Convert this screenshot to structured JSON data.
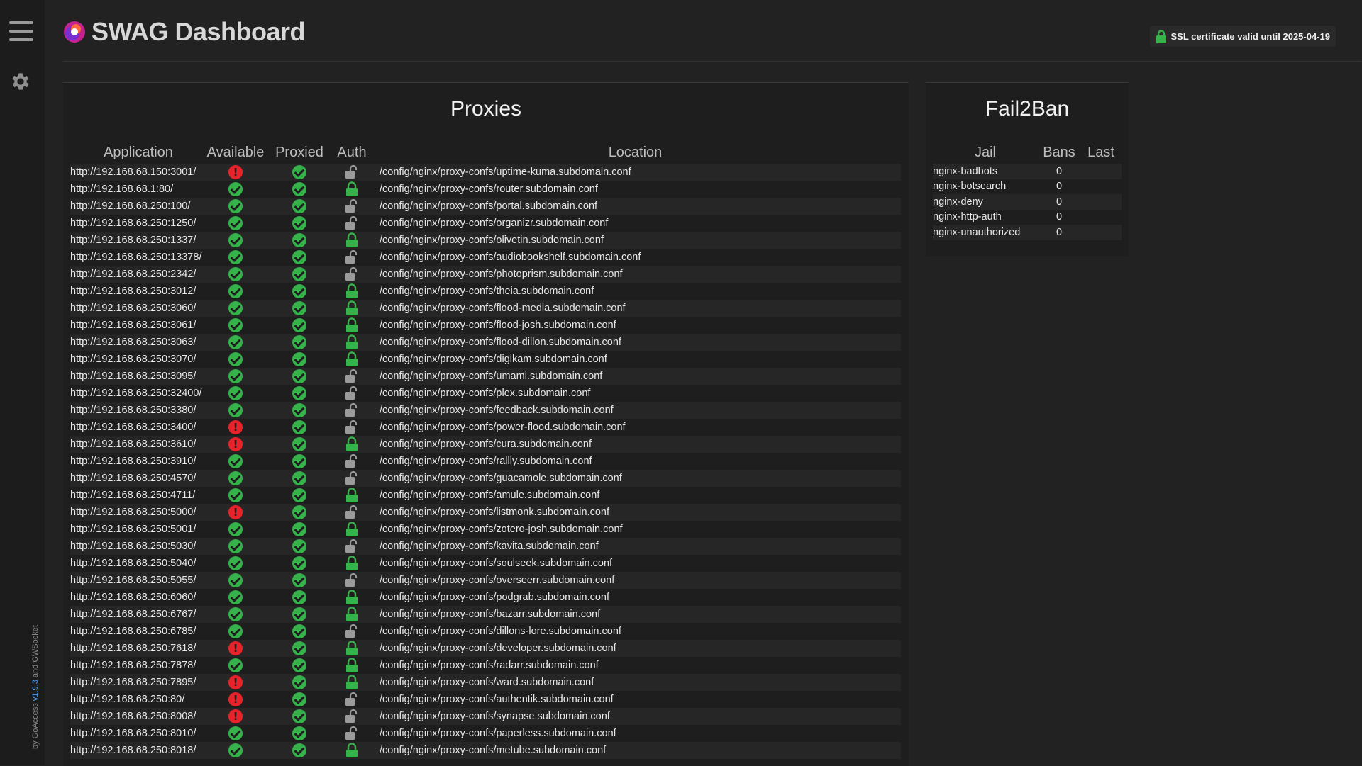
{
  "nav": {
    "menu_icon": "hamburger-menu-icon",
    "settings_icon": "gear-icon"
  },
  "credits": {
    "prefix": "by GoAccess",
    "version": "v1.9.3",
    "joiner": "and",
    "suffix": "GWSocket"
  },
  "header": {
    "title": "SWAG Dashboard",
    "ssl_text": "SSL certificate valid until 2025-04-19",
    "ssl_icon": "lock-closed-icon"
  },
  "colors": {
    "ok": "#35b24a",
    "error": "#e8232a",
    "lock_closed": "#35b24a",
    "lock_open": "#9a9a9a",
    "background": "#222222"
  },
  "proxies": {
    "title": "Proxies",
    "columns": [
      "Application",
      "Available",
      "Proxied",
      "Auth",
      "Location"
    ],
    "rows": [
      {
        "app": "http://192.168.68.150:3001/",
        "available": false,
        "proxied": true,
        "auth": false,
        "location": "/config/nginx/proxy-confs/uptime-kuma.subdomain.conf"
      },
      {
        "app": "http://192.168.68.1:80/",
        "available": true,
        "proxied": true,
        "auth": true,
        "location": "/config/nginx/proxy-confs/router.subdomain.conf"
      },
      {
        "app": "http://192.168.68.250:100/",
        "available": true,
        "proxied": true,
        "auth": false,
        "location": "/config/nginx/proxy-confs/portal.subdomain.conf"
      },
      {
        "app": "http://192.168.68.250:1250/",
        "available": true,
        "proxied": true,
        "auth": false,
        "location": "/config/nginx/proxy-confs/organizr.subdomain.conf"
      },
      {
        "app": "http://192.168.68.250:1337/",
        "available": true,
        "proxied": true,
        "auth": true,
        "location": "/config/nginx/proxy-confs/olivetin.subdomain.conf"
      },
      {
        "app": "http://192.168.68.250:13378/",
        "available": true,
        "proxied": true,
        "auth": false,
        "location": "/config/nginx/proxy-confs/audiobookshelf.subdomain.conf"
      },
      {
        "app": "http://192.168.68.250:2342/",
        "available": true,
        "proxied": true,
        "auth": false,
        "location": "/config/nginx/proxy-confs/photoprism.subdomain.conf"
      },
      {
        "app": "http://192.168.68.250:3012/",
        "available": true,
        "proxied": true,
        "auth": true,
        "location": "/config/nginx/proxy-confs/theia.subdomain.conf"
      },
      {
        "app": "http://192.168.68.250:3060/",
        "available": true,
        "proxied": true,
        "auth": true,
        "location": "/config/nginx/proxy-confs/flood-media.subdomain.conf"
      },
      {
        "app": "http://192.168.68.250:3061/",
        "available": true,
        "proxied": true,
        "auth": true,
        "location": "/config/nginx/proxy-confs/flood-josh.subdomain.conf"
      },
      {
        "app": "http://192.168.68.250:3063/",
        "available": true,
        "proxied": true,
        "auth": true,
        "location": "/config/nginx/proxy-confs/flood-dillon.subdomain.conf"
      },
      {
        "app": "http://192.168.68.250:3070/",
        "available": true,
        "proxied": true,
        "auth": true,
        "location": "/config/nginx/proxy-confs/digikam.subdomain.conf"
      },
      {
        "app": "http://192.168.68.250:3095/",
        "available": true,
        "proxied": true,
        "auth": false,
        "location": "/config/nginx/proxy-confs/umami.subdomain.conf"
      },
      {
        "app": "http://192.168.68.250:32400/",
        "available": true,
        "proxied": true,
        "auth": false,
        "location": "/config/nginx/proxy-confs/plex.subdomain.conf"
      },
      {
        "app": "http://192.168.68.250:3380/",
        "available": true,
        "proxied": true,
        "auth": false,
        "location": "/config/nginx/proxy-confs/feedback.subdomain.conf"
      },
      {
        "app": "http://192.168.68.250:3400/",
        "available": false,
        "proxied": true,
        "auth": false,
        "location": "/config/nginx/proxy-confs/power-flood.subdomain.conf"
      },
      {
        "app": "http://192.168.68.250:3610/",
        "available": false,
        "proxied": true,
        "auth": true,
        "location": "/config/nginx/proxy-confs/cura.subdomain.conf"
      },
      {
        "app": "http://192.168.68.250:3910/",
        "available": true,
        "proxied": true,
        "auth": false,
        "location": "/config/nginx/proxy-confs/rallly.subdomain.conf"
      },
      {
        "app": "http://192.168.68.250:4570/",
        "available": true,
        "proxied": true,
        "auth": false,
        "location": "/config/nginx/proxy-confs/guacamole.subdomain.conf"
      },
      {
        "app": "http://192.168.68.250:4711/",
        "available": true,
        "proxied": true,
        "auth": true,
        "location": "/config/nginx/proxy-confs/amule.subdomain.conf"
      },
      {
        "app": "http://192.168.68.250:5000/",
        "available": false,
        "proxied": true,
        "auth": false,
        "location": "/config/nginx/proxy-confs/listmonk.subdomain.conf"
      },
      {
        "app": "http://192.168.68.250:5001/",
        "available": true,
        "proxied": true,
        "auth": true,
        "location": "/config/nginx/proxy-confs/zotero-josh.subdomain.conf"
      },
      {
        "app": "http://192.168.68.250:5030/",
        "available": true,
        "proxied": true,
        "auth": false,
        "location": "/config/nginx/proxy-confs/kavita.subdomain.conf"
      },
      {
        "app": "http://192.168.68.250:5040/",
        "available": true,
        "proxied": true,
        "auth": true,
        "location": "/config/nginx/proxy-confs/soulseek.subdomain.conf"
      },
      {
        "app": "http://192.168.68.250:5055/",
        "available": true,
        "proxied": true,
        "auth": false,
        "location": "/config/nginx/proxy-confs/overseerr.subdomain.conf"
      },
      {
        "app": "http://192.168.68.250:6060/",
        "available": true,
        "proxied": true,
        "auth": true,
        "location": "/config/nginx/proxy-confs/podgrab.subdomain.conf"
      },
      {
        "app": "http://192.168.68.250:6767/",
        "available": true,
        "proxied": true,
        "auth": true,
        "location": "/config/nginx/proxy-confs/bazarr.subdomain.conf"
      },
      {
        "app": "http://192.168.68.250:6785/",
        "available": true,
        "proxied": true,
        "auth": false,
        "location": "/config/nginx/proxy-confs/dillons-lore.subdomain.conf"
      },
      {
        "app": "http://192.168.68.250:7618/",
        "available": false,
        "proxied": true,
        "auth": true,
        "location": "/config/nginx/proxy-confs/developer.subdomain.conf"
      },
      {
        "app": "http://192.168.68.250:7878/",
        "available": true,
        "proxied": true,
        "auth": true,
        "location": "/config/nginx/proxy-confs/radarr.subdomain.conf"
      },
      {
        "app": "http://192.168.68.250:7895/",
        "available": false,
        "proxied": true,
        "auth": true,
        "location": "/config/nginx/proxy-confs/ward.subdomain.conf"
      },
      {
        "app": "http://192.168.68.250:80/",
        "available": false,
        "proxied": true,
        "auth": false,
        "location": "/config/nginx/proxy-confs/authentik.subdomain.conf"
      },
      {
        "app": "http://192.168.68.250:8008/",
        "available": false,
        "proxied": true,
        "auth": false,
        "location": "/config/nginx/proxy-confs/synapse.subdomain.conf"
      },
      {
        "app": "http://192.168.68.250:8010/",
        "available": true,
        "proxied": true,
        "auth": false,
        "location": "/config/nginx/proxy-confs/paperless.subdomain.conf"
      },
      {
        "app": "http://192.168.68.250:8018/",
        "available": true,
        "proxied": true,
        "auth": true,
        "location": "/config/nginx/proxy-confs/metube.subdomain.conf"
      }
    ]
  },
  "fail2ban": {
    "title": "Fail2Ban",
    "columns": [
      "Jail",
      "Bans",
      "Last"
    ],
    "rows": [
      {
        "jail": "nginx-badbots",
        "bans": "0",
        "last": ""
      },
      {
        "jail": "nginx-botsearch",
        "bans": "0",
        "last": ""
      },
      {
        "jail": "nginx-deny",
        "bans": "0",
        "last": ""
      },
      {
        "jail": "nginx-http-auth",
        "bans": "0",
        "last": ""
      },
      {
        "jail": "nginx-unauthorized",
        "bans": "0",
        "last": ""
      }
    ]
  }
}
